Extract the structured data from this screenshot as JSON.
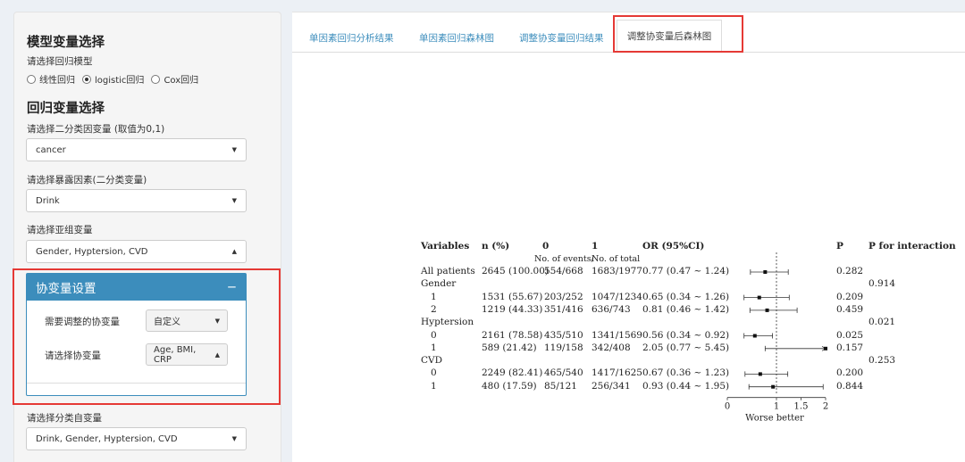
{
  "sidebar": {
    "model_title": "模型变量选择",
    "model_prompt": "请选择回归模型",
    "model_options": [
      "线性回归",
      "logistic回归",
      "Cox回归"
    ],
    "model_selected": "logistic回归",
    "reg_title": "回归变量选择",
    "outcome_label": "请选择二分类因变量 (取值为0,1)",
    "outcome_value": "cancer",
    "exposure_label": "请选择暴露因素(二分类变量)",
    "exposure_value": "Drink",
    "subgroup_label": "请选择亚组变量",
    "subgroup_value": "Gender, Hyptersion, CVD",
    "cov_panel_title": "协变量设置",
    "cov_collapse": "−",
    "cov_need_label": "需要调整的协变量",
    "cov_need_value": "自定义",
    "cov_select_label": "请选择协变量",
    "cov_select_value": "Age, BMI, CRP",
    "cat_label": "请选择分类自变量",
    "cat_value": "Drink, Gender, Hyptersion, CVD"
  },
  "tabs": [
    {
      "label": "单因素回归分析结果",
      "active": false
    },
    {
      "label": "单因素回归森林图",
      "active": false
    },
    {
      "label": "调整协变量回归结果",
      "active": false
    },
    {
      "label": "调整协变量后森林图",
      "active": true
    }
  ],
  "forest": {
    "headers": {
      "variables": "Variables",
      "n": "n (%)",
      "g0": "0",
      "g1": "1",
      "or": "OR (95%CI)",
      "p": "P",
      "pint": "P for interaction",
      "sub_events": "No. of events/",
      "sub_total": "No. of total"
    },
    "rows": [
      {
        "var": "All patients",
        "indent": false,
        "n": "2645 (100.00)",
        "g0": "554/668",
        "g1": "1683/1977",
        "or_text": "0.77 (0.47 ~ 1.24)",
        "p": "0.282",
        "pint": "",
        "est": 0.77,
        "lo": 0.47,
        "hi": 1.24
      },
      {
        "var": "Gender",
        "indent": false,
        "n": "",
        "g0": "",
        "g1": "",
        "or_text": "",
        "p": "",
        "pint": "0.914"
      },
      {
        "var": "1",
        "indent": true,
        "n": "1531 (55.67)",
        "g0": "203/252",
        "g1": "1047/1234",
        "or_text": "0.65 (0.34 ~ 1.26)",
        "p": "0.209",
        "pint": "",
        "est": 0.65,
        "lo": 0.34,
        "hi": 1.26
      },
      {
        "var": "2",
        "indent": true,
        "n": "1219 (44.33)",
        "g0": "351/416",
        "g1": "636/743",
        "or_text": "0.81 (0.46 ~ 1.42)",
        "p": "0.459",
        "pint": "",
        "est": 0.81,
        "lo": 0.46,
        "hi": 1.42
      },
      {
        "var": "Hyptersion",
        "indent": false,
        "n": "",
        "g0": "",
        "g1": "",
        "or_text": "",
        "p": "",
        "pint": "0.021"
      },
      {
        "var": "0",
        "indent": true,
        "n": "2161 (78.58)",
        "g0": "435/510",
        "g1": "1341/1569",
        "or_text": "0.56 (0.34 ~ 0.92)",
        "p": "0.025",
        "pint": "",
        "est": 0.56,
        "lo": 0.34,
        "hi": 0.92
      },
      {
        "var": "1",
        "indent": true,
        "n": "589 (21.42)",
        "g0": "119/158",
        "g1": "342/408",
        "or_text": "2.05 (0.77 ~ 5.45)",
        "p": "0.157",
        "pint": "",
        "est": 2.05,
        "lo": 0.77,
        "hi": 5.45
      },
      {
        "var": "CVD",
        "indent": false,
        "n": "",
        "g0": "",
        "g1": "",
        "or_text": "",
        "p": "",
        "pint": "0.253"
      },
      {
        "var": "0",
        "indent": true,
        "n": "2249 (82.41)",
        "g0": "465/540",
        "g1": "1417/1625",
        "or_text": "0.67 (0.36 ~ 1.23)",
        "p": "0.200",
        "pint": "",
        "est": 0.67,
        "lo": 0.36,
        "hi": 1.23
      },
      {
        "var": "1",
        "indent": true,
        "n": "480 (17.59)",
        "g0": "85/121",
        "g1": "256/341",
        "or_text": "0.93 (0.44 ~ 1.95)",
        "p": "0.844",
        "pint": "",
        "est": 0.93,
        "lo": 0.44,
        "hi": 1.95
      }
    ],
    "axis_ticks": [
      "0",
      "1",
      "1.5",
      "2"
    ],
    "axis_tick_values": [
      0,
      1,
      1.5,
      2
    ],
    "axis_label": "Worse  better",
    "xlim": [
      0,
      2
    ],
    "ref_line": 1
  }
}
